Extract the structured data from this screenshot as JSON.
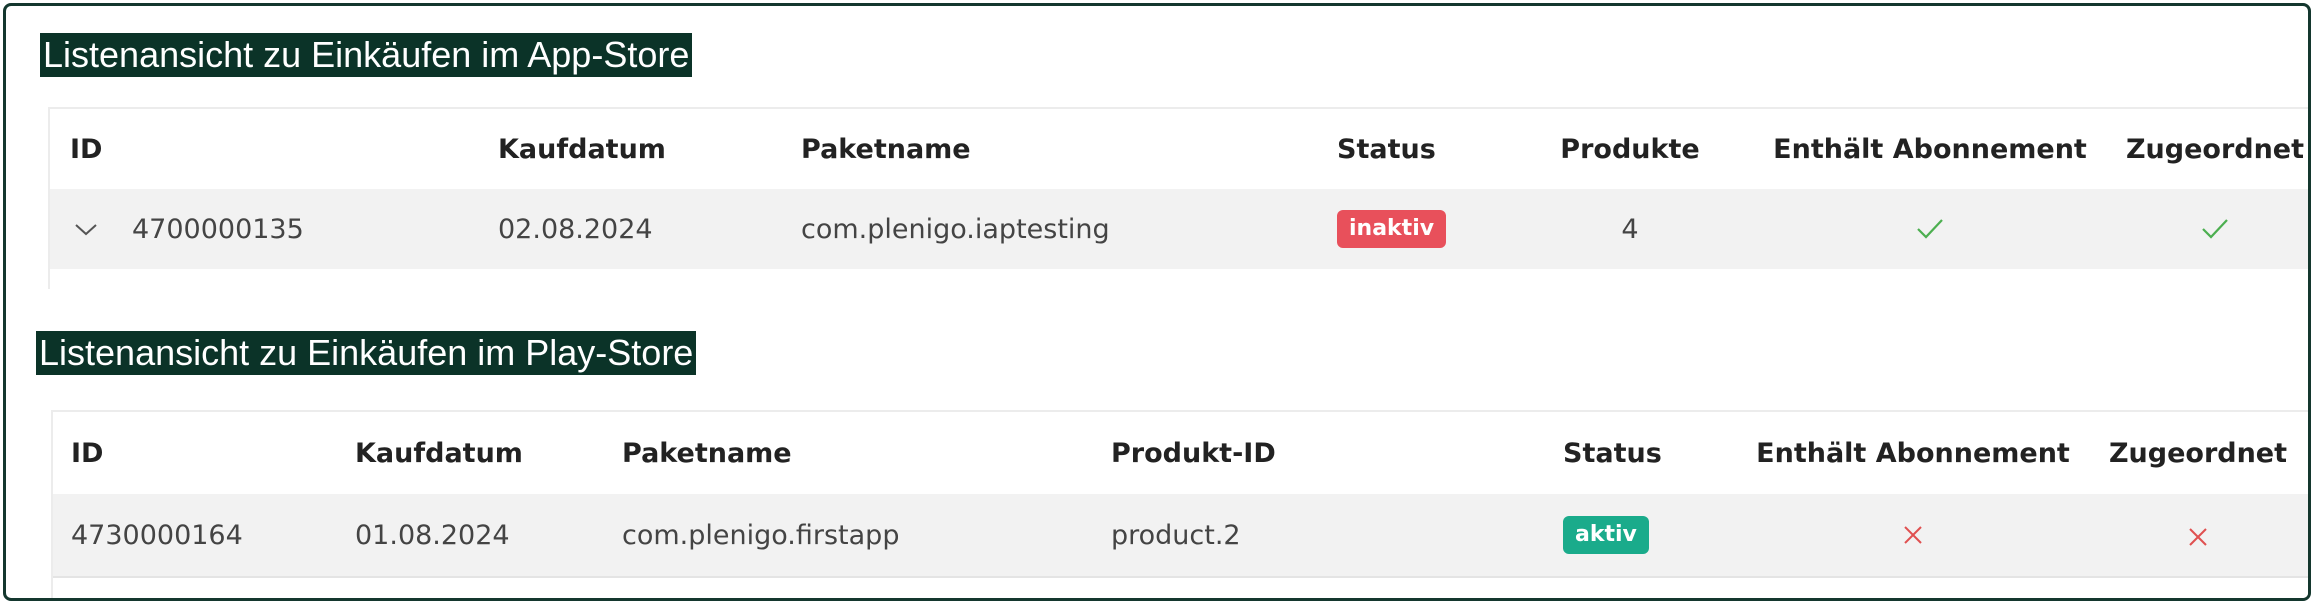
{
  "app_store": {
    "title": "Listenansicht zu Einkäufen im App-Store",
    "columns": [
      "ID",
      "Kaufdatum",
      "Paketname",
      "Status",
      "Produkte",
      "Enthält Abonnement",
      "Zugeordnet"
    ],
    "row": {
      "id": "4700000135",
      "date": "02.08.2024",
      "package": "com.plenigo.iaptesting",
      "status": "inaktiv",
      "products": "4",
      "has_subscription": true,
      "assigned": true
    }
  },
  "play_store": {
    "title": "Listenansicht zu Einkäufen im Play-Store",
    "columns": [
      "ID",
      "Kaufdatum",
      "Paketname",
      "Produkt-ID",
      "Status",
      "Enthält Abonnement",
      "Zugeordnet"
    ],
    "row": {
      "id": "4730000164",
      "date": "01.08.2024",
      "package": "com.plenigo.firstapp",
      "product_id": "product.2",
      "status": "aktiv",
      "has_subscription": false,
      "assigned": false
    }
  },
  "colors": {
    "heading_bg": "#0b3328",
    "link": "#4b7fae",
    "status_inactive": "#e8505b",
    "status_active": "#1aab8b",
    "check": "#4caf50",
    "cross": "#e05050"
  },
  "icons": {
    "expand": "chevron-down-icon",
    "yes": "check-icon",
    "no": "cross-icon"
  }
}
